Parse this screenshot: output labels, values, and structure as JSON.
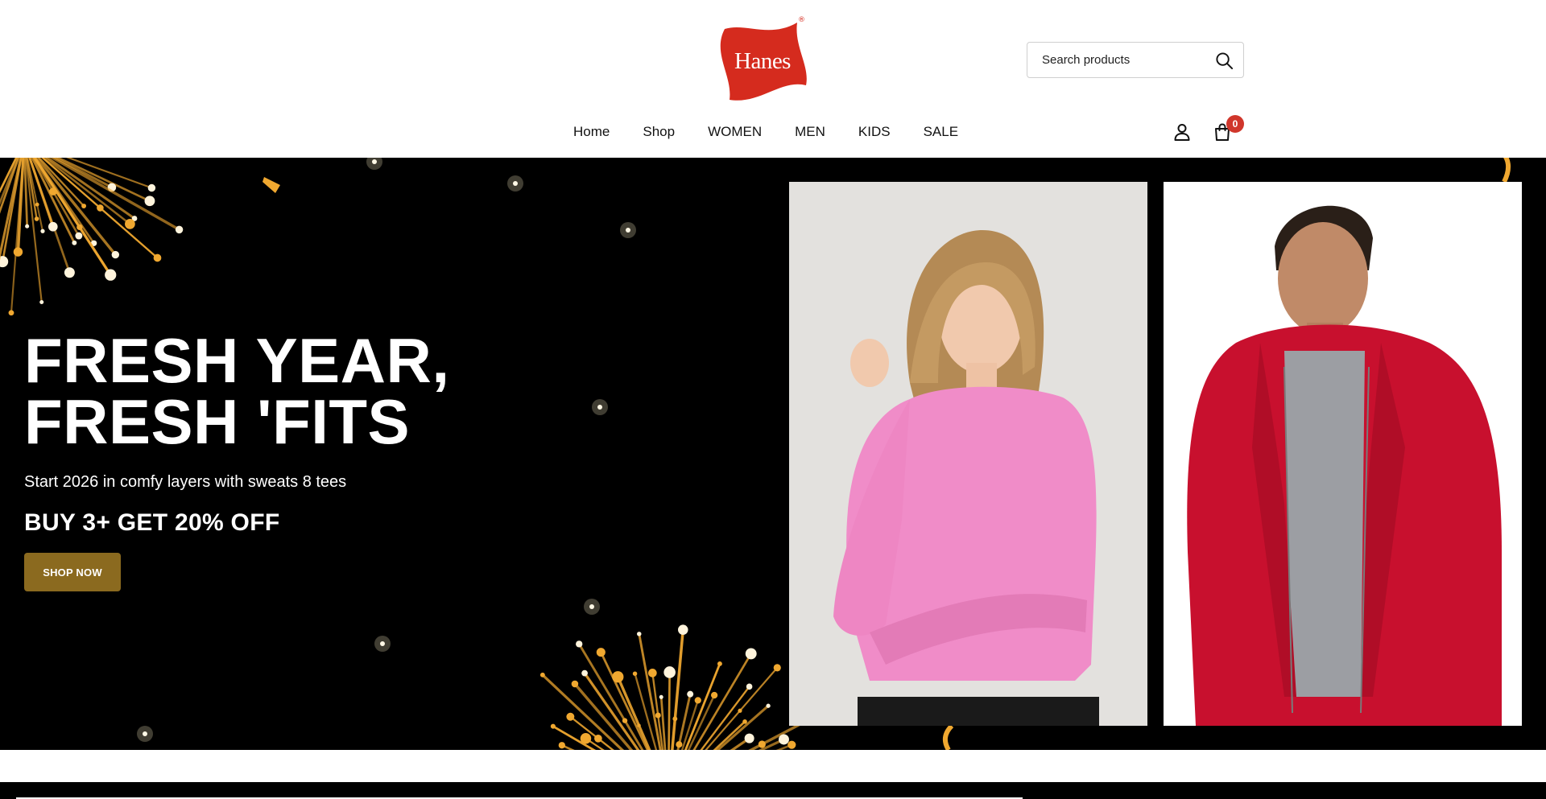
{
  "brand": {
    "logo_text": "Hanes",
    "logo_reg": "®",
    "logo_color": "#d52b1e"
  },
  "search": {
    "placeholder": "Search products",
    "icon": "search-icon"
  },
  "nav": {
    "items": [
      "Home",
      "Shop",
      "WOMEN",
      "MEN",
      "KIDS",
      "SALE"
    ]
  },
  "utility": {
    "account_icon": "user-icon",
    "cart_icon": "shopping-bag-icon",
    "cart_count": "0",
    "badge_color": "#d0362b"
  },
  "hero": {
    "title": "FRESH YEAR, FRESH 'FITS",
    "subtitle": "Start 2026 in comfy layers with sweats 8 tees",
    "offer": "BUY 3+ GET 20% OFF",
    "cta_label": "SHOP NOW",
    "cta_color": "#8b6a1f",
    "background": "#000000",
    "accent": "#f0a830"
  }
}
